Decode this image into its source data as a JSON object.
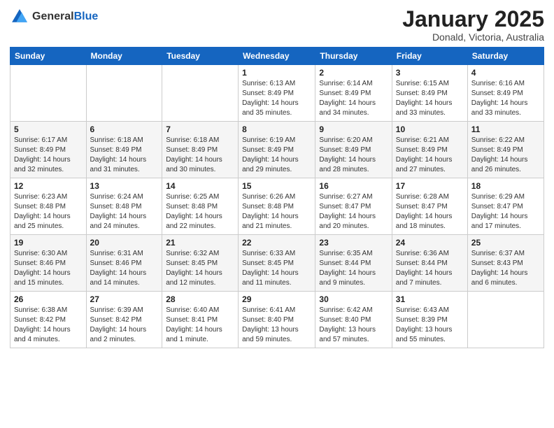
{
  "header": {
    "logo_general": "General",
    "logo_blue": "Blue",
    "month_title": "January 2025",
    "location": "Donald, Victoria, Australia"
  },
  "weekdays": [
    "Sunday",
    "Monday",
    "Tuesday",
    "Wednesday",
    "Thursday",
    "Friday",
    "Saturday"
  ],
  "weeks": [
    [
      {
        "day": "",
        "info": ""
      },
      {
        "day": "",
        "info": ""
      },
      {
        "day": "",
        "info": ""
      },
      {
        "day": "1",
        "info": "Sunrise: 6:13 AM\nSunset: 8:49 PM\nDaylight: 14 hours\nand 35 minutes."
      },
      {
        "day": "2",
        "info": "Sunrise: 6:14 AM\nSunset: 8:49 PM\nDaylight: 14 hours\nand 34 minutes."
      },
      {
        "day": "3",
        "info": "Sunrise: 6:15 AM\nSunset: 8:49 PM\nDaylight: 14 hours\nand 33 minutes."
      },
      {
        "day": "4",
        "info": "Sunrise: 6:16 AM\nSunset: 8:49 PM\nDaylight: 14 hours\nand 33 minutes."
      }
    ],
    [
      {
        "day": "5",
        "info": "Sunrise: 6:17 AM\nSunset: 8:49 PM\nDaylight: 14 hours\nand 32 minutes."
      },
      {
        "day": "6",
        "info": "Sunrise: 6:18 AM\nSunset: 8:49 PM\nDaylight: 14 hours\nand 31 minutes."
      },
      {
        "day": "7",
        "info": "Sunrise: 6:18 AM\nSunset: 8:49 PM\nDaylight: 14 hours\nand 30 minutes."
      },
      {
        "day": "8",
        "info": "Sunrise: 6:19 AM\nSunset: 8:49 PM\nDaylight: 14 hours\nand 29 minutes."
      },
      {
        "day": "9",
        "info": "Sunrise: 6:20 AM\nSunset: 8:49 PM\nDaylight: 14 hours\nand 28 minutes."
      },
      {
        "day": "10",
        "info": "Sunrise: 6:21 AM\nSunset: 8:49 PM\nDaylight: 14 hours\nand 27 minutes."
      },
      {
        "day": "11",
        "info": "Sunrise: 6:22 AM\nSunset: 8:49 PM\nDaylight: 14 hours\nand 26 minutes."
      }
    ],
    [
      {
        "day": "12",
        "info": "Sunrise: 6:23 AM\nSunset: 8:48 PM\nDaylight: 14 hours\nand 25 minutes."
      },
      {
        "day": "13",
        "info": "Sunrise: 6:24 AM\nSunset: 8:48 PM\nDaylight: 14 hours\nand 24 minutes."
      },
      {
        "day": "14",
        "info": "Sunrise: 6:25 AM\nSunset: 8:48 PM\nDaylight: 14 hours\nand 22 minutes."
      },
      {
        "day": "15",
        "info": "Sunrise: 6:26 AM\nSunset: 8:48 PM\nDaylight: 14 hours\nand 21 minutes."
      },
      {
        "day": "16",
        "info": "Sunrise: 6:27 AM\nSunset: 8:47 PM\nDaylight: 14 hours\nand 20 minutes."
      },
      {
        "day": "17",
        "info": "Sunrise: 6:28 AM\nSunset: 8:47 PM\nDaylight: 14 hours\nand 18 minutes."
      },
      {
        "day": "18",
        "info": "Sunrise: 6:29 AM\nSunset: 8:47 PM\nDaylight: 14 hours\nand 17 minutes."
      }
    ],
    [
      {
        "day": "19",
        "info": "Sunrise: 6:30 AM\nSunset: 8:46 PM\nDaylight: 14 hours\nand 15 minutes."
      },
      {
        "day": "20",
        "info": "Sunrise: 6:31 AM\nSunset: 8:46 PM\nDaylight: 14 hours\nand 14 minutes."
      },
      {
        "day": "21",
        "info": "Sunrise: 6:32 AM\nSunset: 8:45 PM\nDaylight: 14 hours\nand 12 minutes."
      },
      {
        "day": "22",
        "info": "Sunrise: 6:33 AM\nSunset: 8:45 PM\nDaylight: 14 hours\nand 11 minutes."
      },
      {
        "day": "23",
        "info": "Sunrise: 6:35 AM\nSunset: 8:44 PM\nDaylight: 14 hours\nand 9 minutes."
      },
      {
        "day": "24",
        "info": "Sunrise: 6:36 AM\nSunset: 8:44 PM\nDaylight: 14 hours\nand 7 minutes."
      },
      {
        "day": "25",
        "info": "Sunrise: 6:37 AM\nSunset: 8:43 PM\nDaylight: 14 hours\nand 6 minutes."
      }
    ],
    [
      {
        "day": "26",
        "info": "Sunrise: 6:38 AM\nSunset: 8:42 PM\nDaylight: 14 hours\nand 4 minutes."
      },
      {
        "day": "27",
        "info": "Sunrise: 6:39 AM\nSunset: 8:42 PM\nDaylight: 14 hours\nand 2 minutes."
      },
      {
        "day": "28",
        "info": "Sunrise: 6:40 AM\nSunset: 8:41 PM\nDaylight: 14 hours\nand 1 minute."
      },
      {
        "day": "29",
        "info": "Sunrise: 6:41 AM\nSunset: 8:40 PM\nDaylight: 13 hours\nand 59 minutes."
      },
      {
        "day": "30",
        "info": "Sunrise: 6:42 AM\nSunset: 8:40 PM\nDaylight: 13 hours\nand 57 minutes."
      },
      {
        "day": "31",
        "info": "Sunrise: 6:43 AM\nSunset: 8:39 PM\nDaylight: 13 hours\nand 55 minutes."
      },
      {
        "day": "",
        "info": ""
      }
    ]
  ]
}
